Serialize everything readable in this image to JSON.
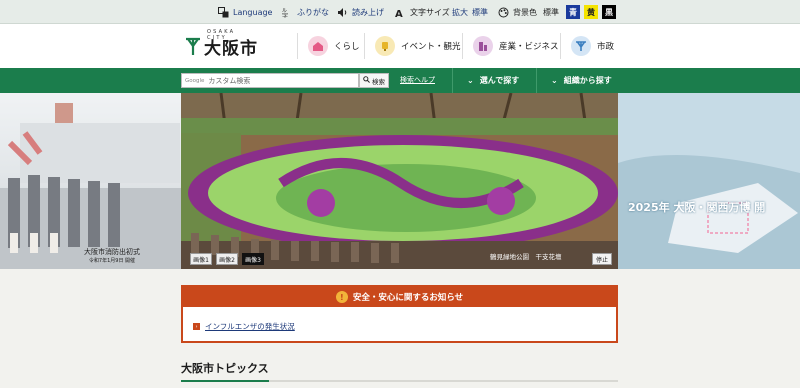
{
  "utility": {
    "language": "Language",
    "furigana": "ふりがな",
    "read_aloud": "読み上げ",
    "text_size_label": "文字サイズ",
    "text_size_enlarge": "拡大",
    "text_size_standard": "標準",
    "bg_color_label": "背景色",
    "bg_standard": "標準",
    "bg_blue": "青",
    "bg_yellow": "黄",
    "bg_black": "黒"
  },
  "header": {
    "logo_osaka": "OSAKA CITY",
    "logo_name": "大阪市",
    "nav": [
      {
        "label": "くらし",
        "icon": "house-icon",
        "color": "#e45a86"
      },
      {
        "label": "イベント・観光",
        "icon": "lamp-icon",
        "color": "#e6b52a"
      },
      {
        "label": "産業・ビジネス",
        "icon": "building-icon",
        "color": "#9a4f9a"
      },
      {
        "label": "市政",
        "icon": "city-emblem-icon",
        "color": "#3b7fc0"
      }
    ]
  },
  "search": {
    "google_label": "Google",
    "placeholder": "カスタム検索",
    "button": "検索",
    "help": "検索ヘルプ",
    "menu_choose": "選んで探す",
    "menu_org": "組織から探す"
  },
  "hero": {
    "left_caption": "大阪市消防出初式",
    "left_caption_sub": "令和7年1月9日 開催",
    "right_title": "2025年 大阪・関西万博 開",
    "thumbs": [
      "画像1",
      "画像2",
      "画像3"
    ],
    "active_thumb": 2,
    "photo_caption": "鶴見緑地公園　干支花壇",
    "stop": "停止"
  },
  "alert": {
    "title": "安全・安心に関するお知らせ",
    "items": [
      "インフルエンザの発生状況"
    ]
  },
  "topics": {
    "title": "大阪市トピックス"
  },
  "colors": {
    "green": "#1b7d4c",
    "alert": "#c9481b",
    "bg_blue": "#1a3a9c",
    "bg_yellow": "#f5e400",
    "bg_black": "#000000"
  }
}
